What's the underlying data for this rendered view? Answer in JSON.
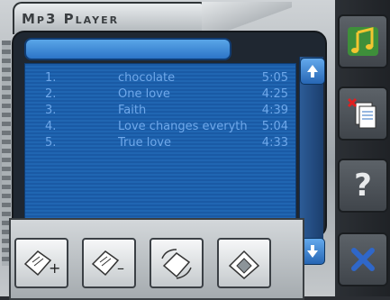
{
  "app": {
    "title": "Mp3 Player"
  },
  "playlist": {
    "tracks": [
      {
        "num": "1.",
        "title": "chocolate",
        "time": "5:05"
      },
      {
        "num": "2.",
        "title": "One love",
        "time": "4:25"
      },
      {
        "num": "3.",
        "title": "Faith",
        "time": "4:39"
      },
      {
        "num": "4.",
        "title": "Love changes everyth",
        "time": "5:04"
      },
      {
        "num": "5.",
        "title": "True love",
        "time": "4:33"
      }
    ]
  },
  "side_buttons": [
    {
      "icon": "music-note-icon"
    },
    {
      "icon": "delete-files-icon"
    },
    {
      "label": "?",
      "icon": "help-icon"
    },
    {
      "icon": "close-x-icon"
    }
  ],
  "toolbar": {
    "add_icon": "add-file-icon",
    "remove_icon": "remove-file-icon",
    "reorder_icon": "rotate-file-icon",
    "save_icon": "save-disk-icon"
  },
  "colors": {
    "accent": "#2066b2",
    "text": "#6fa8ea"
  }
}
